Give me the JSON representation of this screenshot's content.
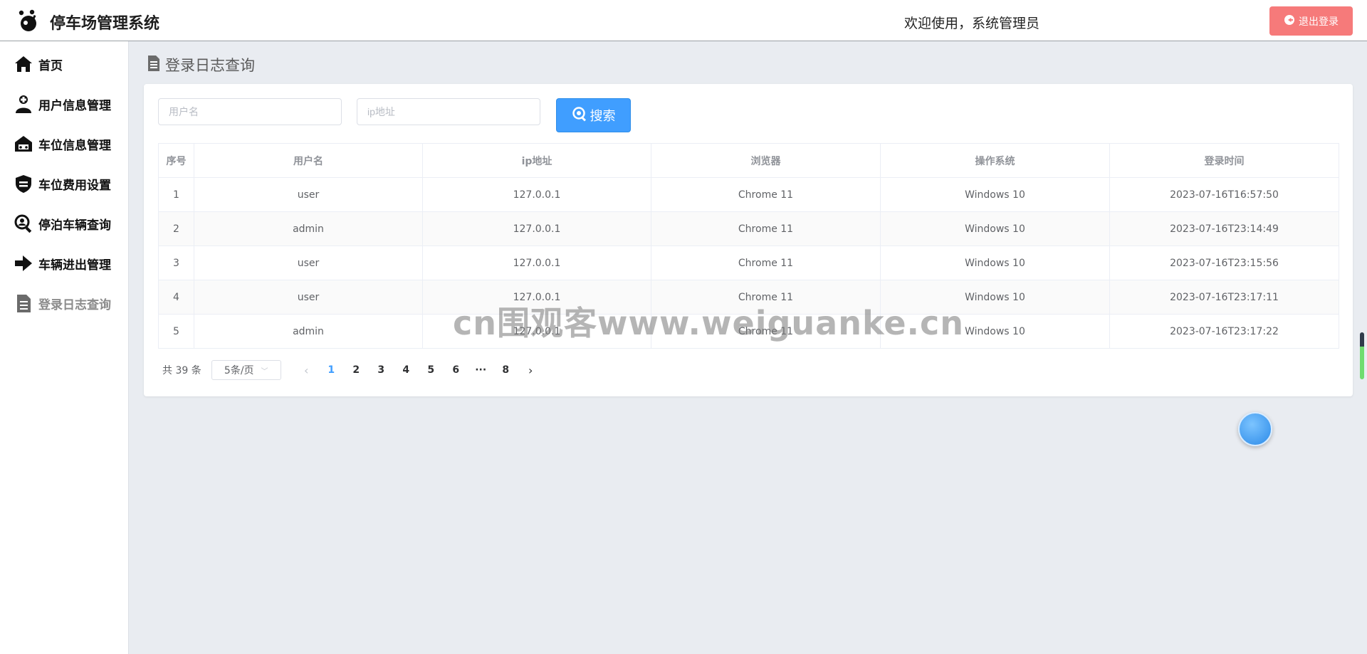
{
  "header": {
    "app_title": "停车场管理系统",
    "welcome": "欢迎使用，系统管理员",
    "logout_label": "退出登录"
  },
  "sidebar": {
    "items": [
      {
        "label": "首页",
        "icon": "home-icon"
      },
      {
        "label": "用户信息管理",
        "icon": "user-plus-icon"
      },
      {
        "label": "车位信息管理",
        "icon": "garage-icon"
      },
      {
        "label": "车位费用设置",
        "icon": "fee-shield-icon"
      },
      {
        "label": "停泊车辆查询",
        "icon": "search-person-icon"
      },
      {
        "label": "车辆进出管理",
        "icon": "arrow-right-icon"
      },
      {
        "label": "登录日志查询",
        "icon": "document-icon",
        "active": true
      }
    ]
  },
  "page": {
    "title": "登录日志查询"
  },
  "search": {
    "username_placeholder": "用户名",
    "ip_placeholder": "ip地址",
    "button_label": "搜索"
  },
  "table": {
    "headers": [
      "序号",
      "用户名",
      "ip地址",
      "浏览器",
      "操作系统",
      "登录时间"
    ],
    "rows": [
      [
        "1",
        "user",
        "127.0.0.1",
        "Chrome 11",
        "Windows 10",
        "2023-07-16T16:57:50"
      ],
      [
        "2",
        "admin",
        "127.0.0.1",
        "Chrome 11",
        "Windows 10",
        "2023-07-16T23:14:49"
      ],
      [
        "3",
        "user",
        "127.0.0.1",
        "Chrome 11",
        "Windows 10",
        "2023-07-16T23:15:56"
      ],
      [
        "4",
        "user",
        "127.0.0.1",
        "Chrome 11",
        "Windows 10",
        "2023-07-16T23:17:11"
      ],
      [
        "5",
        "admin",
        "127.0.0.1",
        "Chrome 11",
        "Windows 10",
        "2023-07-16T23:17:22"
      ]
    ]
  },
  "pagination": {
    "total": "共 39 条",
    "page_size": "5条/页",
    "pages": [
      "1",
      "2",
      "3",
      "4",
      "5",
      "6",
      "···",
      "8"
    ],
    "current": "1"
  },
  "watermark": "cn围观客www.weiguanke.cn",
  "colors": {
    "primary": "#409eff",
    "danger": "#f67a7a",
    "background": "#e9ecf1"
  }
}
